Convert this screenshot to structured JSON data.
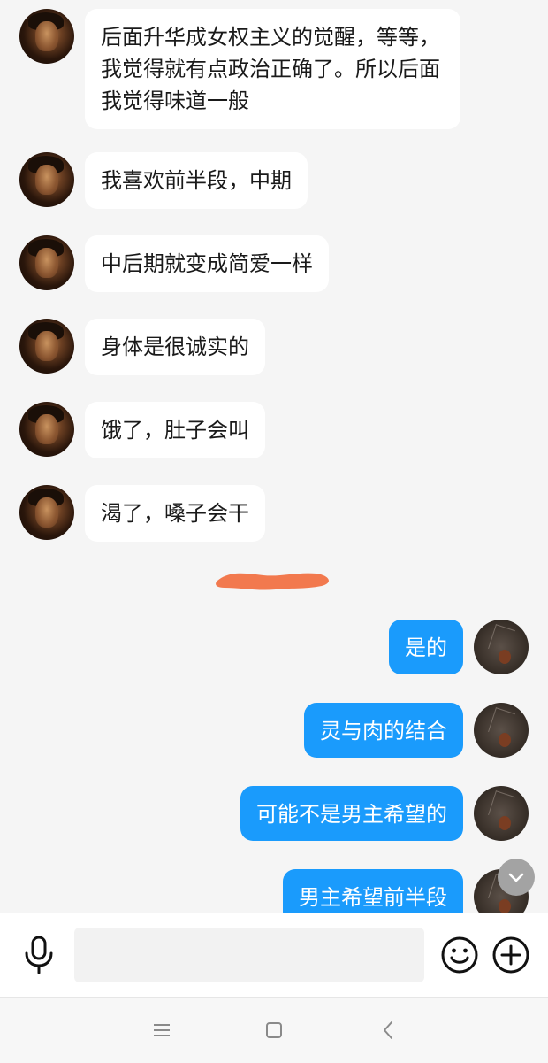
{
  "messages": [
    {
      "side": "in",
      "text": "后面升华成女权主义的觉醒，等等，我觉得就有点政治正确了。所以后面我觉得味道一般"
    },
    {
      "side": "in",
      "text": "我喜欢前半段，中期"
    },
    {
      "side": "in",
      "text": "中后期就变成简爱一样"
    },
    {
      "side": "in",
      "text": "身体是很诚实的"
    },
    {
      "side": "in",
      "text": "饿了，肚子会叫"
    },
    {
      "side": "in",
      "text": "渴了，嗓子会干"
    },
    {
      "side": "out",
      "text": "是的"
    },
    {
      "side": "out",
      "text": "灵与肉的结合"
    },
    {
      "side": "out",
      "text": "可能不是男主希望的"
    },
    {
      "side": "out",
      "text": "男主希望前半段"
    }
  ],
  "input": {
    "value": "",
    "placeholder": ""
  },
  "icons": {
    "mic": "microphone-icon",
    "emoji": "smiley-icon",
    "plus": "plus-icon",
    "scroll": "chevron-down-icon",
    "nav_menu": "menu-icon",
    "nav_home": "square-home-icon",
    "nav_back": "back-chevron-icon"
  },
  "colors": {
    "outgoing_bubble": "#1a9bfc",
    "incoming_bubble": "#ffffff",
    "background": "#f5f5f5",
    "redaction": "#f26b3c"
  }
}
